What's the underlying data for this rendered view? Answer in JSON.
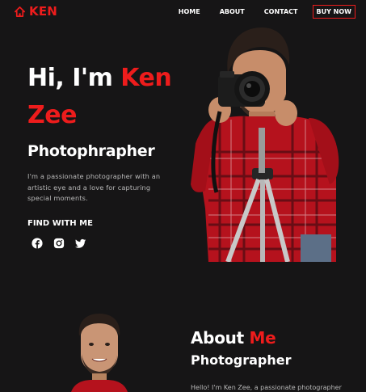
{
  "nav": {
    "logo_text": "KEN",
    "links": [
      "HOME",
      "ABOUT",
      "CONTACT"
    ],
    "buy_label": "BUY NOW"
  },
  "hero": {
    "greeting": "Hi, I'm",
    "name_first": "Ken",
    "name_last": "Zee",
    "role": "Photophrapher",
    "description": "I'm a passionate photographer with an artistic eye and a love for capturing special moments.",
    "find_title": "FIND WITH ME",
    "socials": [
      "facebook-icon",
      "instagram-icon",
      "twitter-icon"
    ]
  },
  "about": {
    "title_white": "About",
    "title_red": "Me",
    "subtitle": "Photographer",
    "text": "Hello! I'm Ken Zee, a passionate photographer"
  },
  "colors": {
    "background": "#161516",
    "accent": "#ee1c1c",
    "text": "#ffffff",
    "muted": "#b9b9b9"
  }
}
